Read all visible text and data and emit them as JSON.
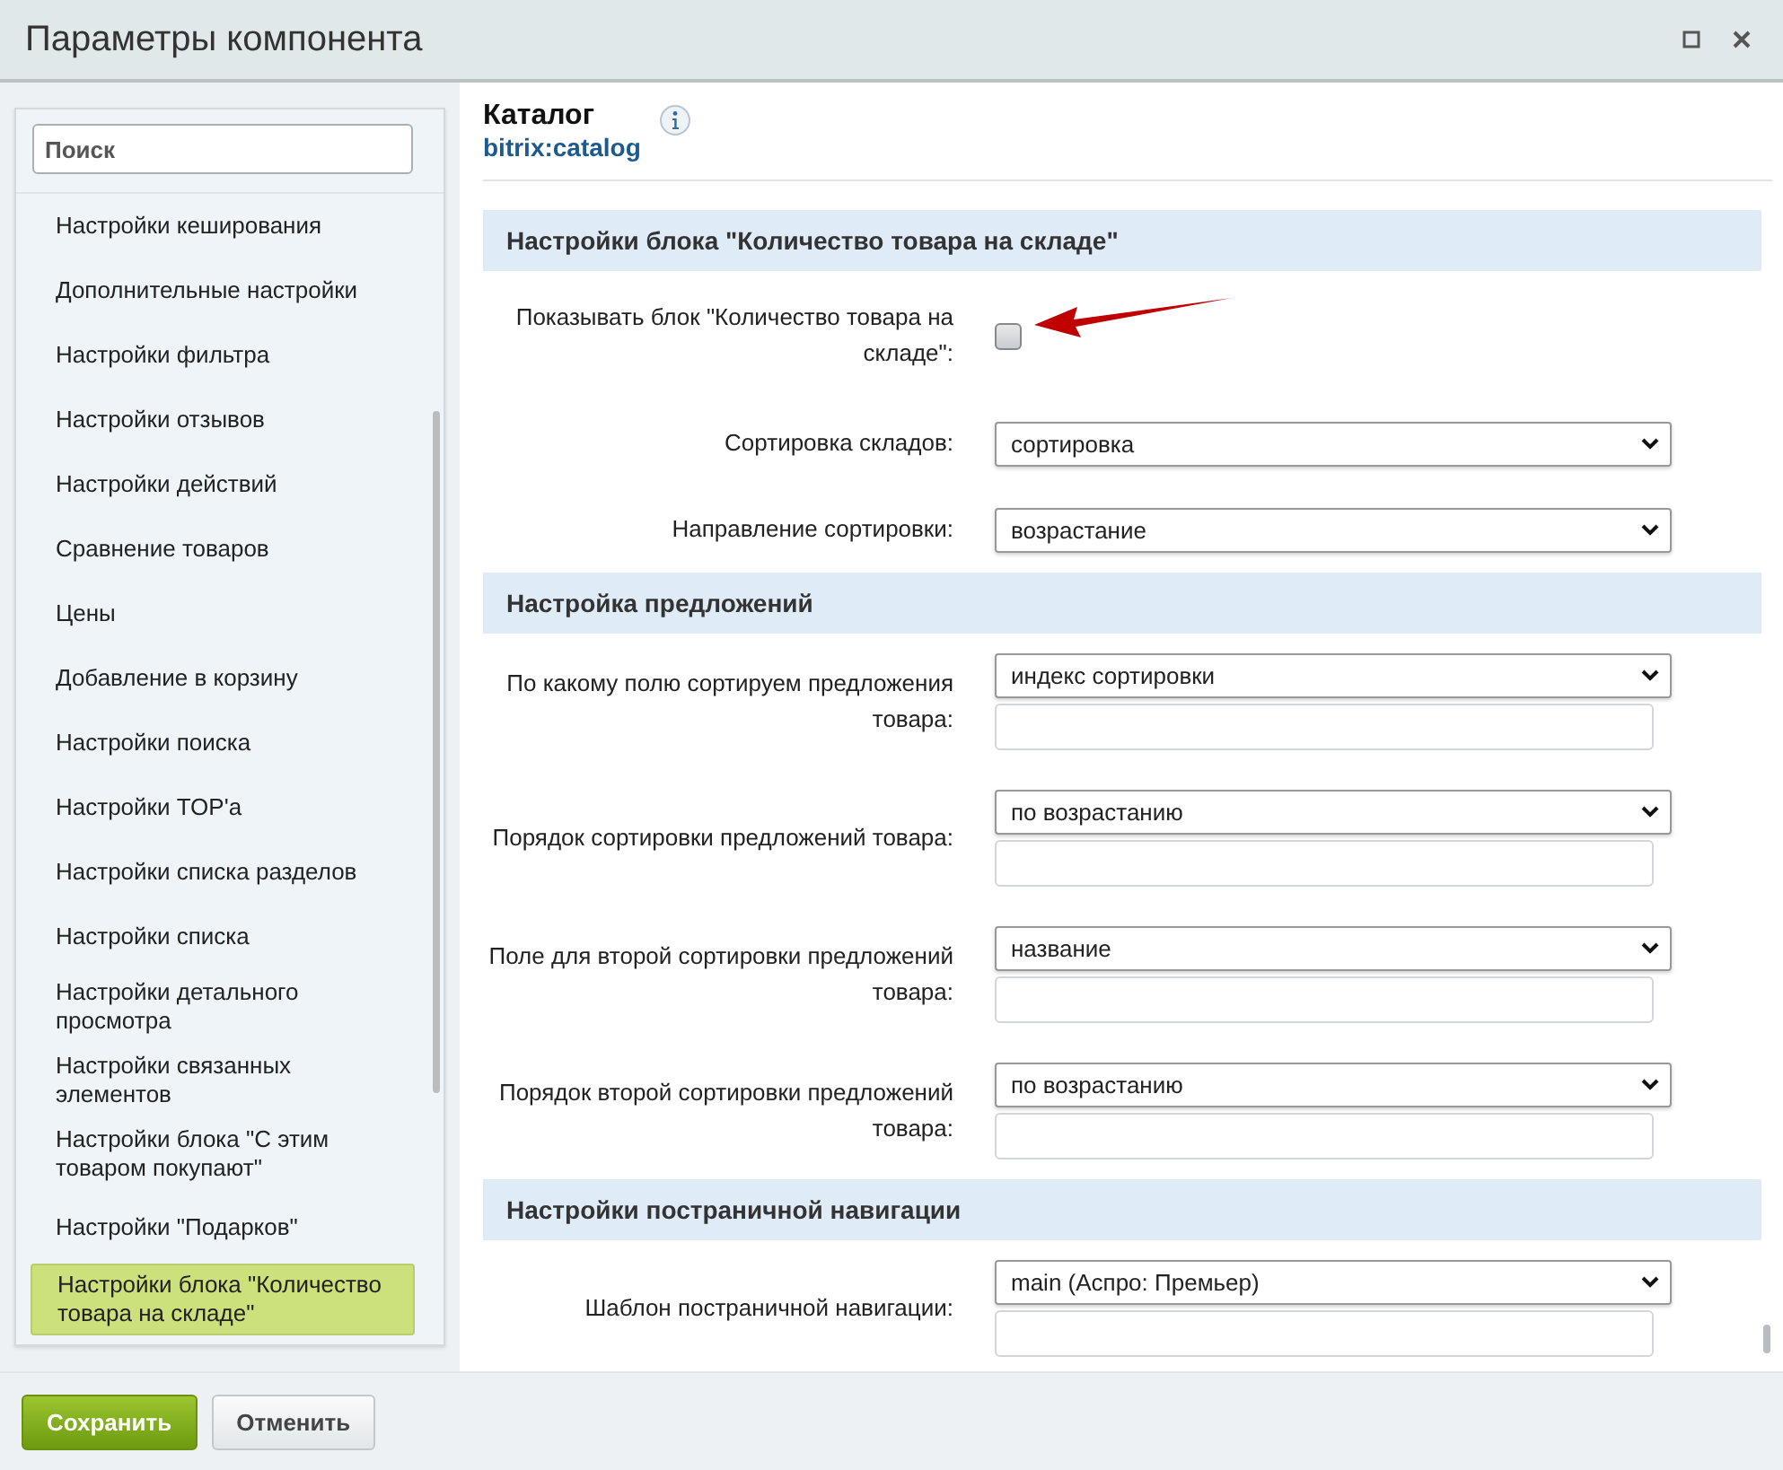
{
  "window": {
    "title": "Параметры компонента"
  },
  "search": {
    "placeholder": "Поиск"
  },
  "sidebar": {
    "items": [
      {
        "label": "Настройки кеширования",
        "selected": false
      },
      {
        "label": "Дополнительные настройки",
        "selected": false
      },
      {
        "label": "Настройки фильтра",
        "selected": false
      },
      {
        "label": "Настройки отзывов",
        "selected": false
      },
      {
        "label": "Настройки действий",
        "selected": false
      },
      {
        "label": "Сравнение товаров",
        "selected": false
      },
      {
        "label": "Цены",
        "selected": false
      },
      {
        "label": "Добавление в корзину",
        "selected": false
      },
      {
        "label": "Настройки поиска",
        "selected": false
      },
      {
        "label": "Настройки TOP'a",
        "selected": false
      },
      {
        "label": "Настройки списка разделов",
        "selected": false
      },
      {
        "label": "Настройки списка",
        "selected": false
      },
      {
        "label": "Настройки детального просмотра",
        "selected": false
      },
      {
        "label": "Настройки связанных элементов",
        "selected": false
      },
      {
        "label": "Настройки блока \"С этим товаром покупают\"",
        "selected": false
      },
      {
        "label": "Настройки \"Подарков\"",
        "selected": false
      },
      {
        "label": "Настройки блока \"Количество товара на складе\"",
        "selected": true
      }
    ]
  },
  "component": {
    "name": "Каталог",
    "code": "bitrix:catalog"
  },
  "sections": [
    {
      "title": "Настройки блока \"Количество товара на складе\"",
      "rows": [
        {
          "kind": "checkbox",
          "label": "Показывать блок \"Количество товара на складе\":",
          "checked": false,
          "annotated": true
        },
        {
          "kind": "select",
          "label": "Сортировка складов:",
          "value": "сортировка",
          "extra_input": false
        },
        {
          "kind": "select",
          "label": "Направление сортировки:",
          "value": "возрастание",
          "extra_input": false
        }
      ]
    },
    {
      "title": "Настройка предложений",
      "rows": [
        {
          "kind": "select",
          "label": "По какому полю сортируем предложения товара:",
          "value": "индекс сортировки",
          "extra_input": true
        },
        {
          "kind": "select",
          "label": "Порядок сортировки предложений товара:",
          "value": "по возрастанию",
          "extra_input": true
        },
        {
          "kind": "select",
          "label": "Поле для второй сортировки предложений товара:",
          "value": "название",
          "extra_input": true
        },
        {
          "kind": "select",
          "label": "Порядок второй сортировки предложений товара:",
          "value": "по возрастанию",
          "extra_input": true
        }
      ]
    },
    {
      "title": "Настройки постраничной навигации",
      "rows": [
        {
          "kind": "select",
          "label": "Шаблон постраничной навигации:",
          "value": "main (Аспро: Премьер)",
          "extra_input": true
        }
      ]
    }
  ],
  "buttons": [
    {
      "label": "Сохранить",
      "kind": "primary"
    },
    {
      "label": "Отменить",
      "kind": "secondary"
    }
  ]
}
